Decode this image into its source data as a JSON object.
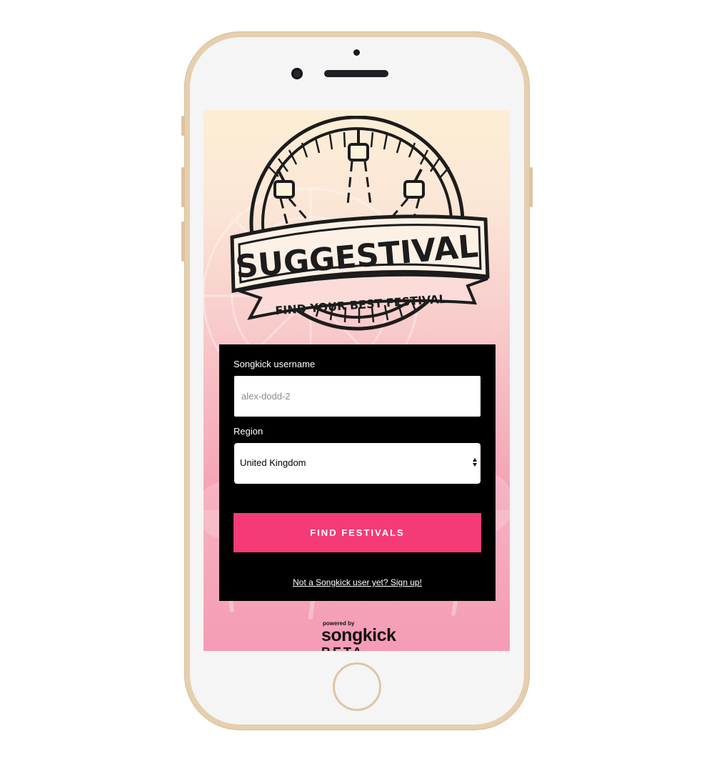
{
  "app": {
    "logo_title": "SUGGESTIVAL",
    "logo_tagline": "FIND YOUR BEST FESTIVAL"
  },
  "form": {
    "username_label": "Songkick username",
    "username_placeholder": "alex-dodd-2",
    "username_value": "",
    "region_label": "Region",
    "region_value": "United Kingdom",
    "submit_label": "FIND FESTIVALS",
    "signup_link": "Not a Songkick user yet? Sign up!"
  },
  "footer": {
    "powered_by": "powered by",
    "brand": "songkick",
    "badge": "BETA"
  },
  "colors": {
    "accent": "#f53b75",
    "card": "#000000",
    "phone_frame": "#e5cfae"
  },
  "icons": {
    "select_arrows": "updown-arrows-icon",
    "logo": "festival-lights-emblem-icon"
  }
}
